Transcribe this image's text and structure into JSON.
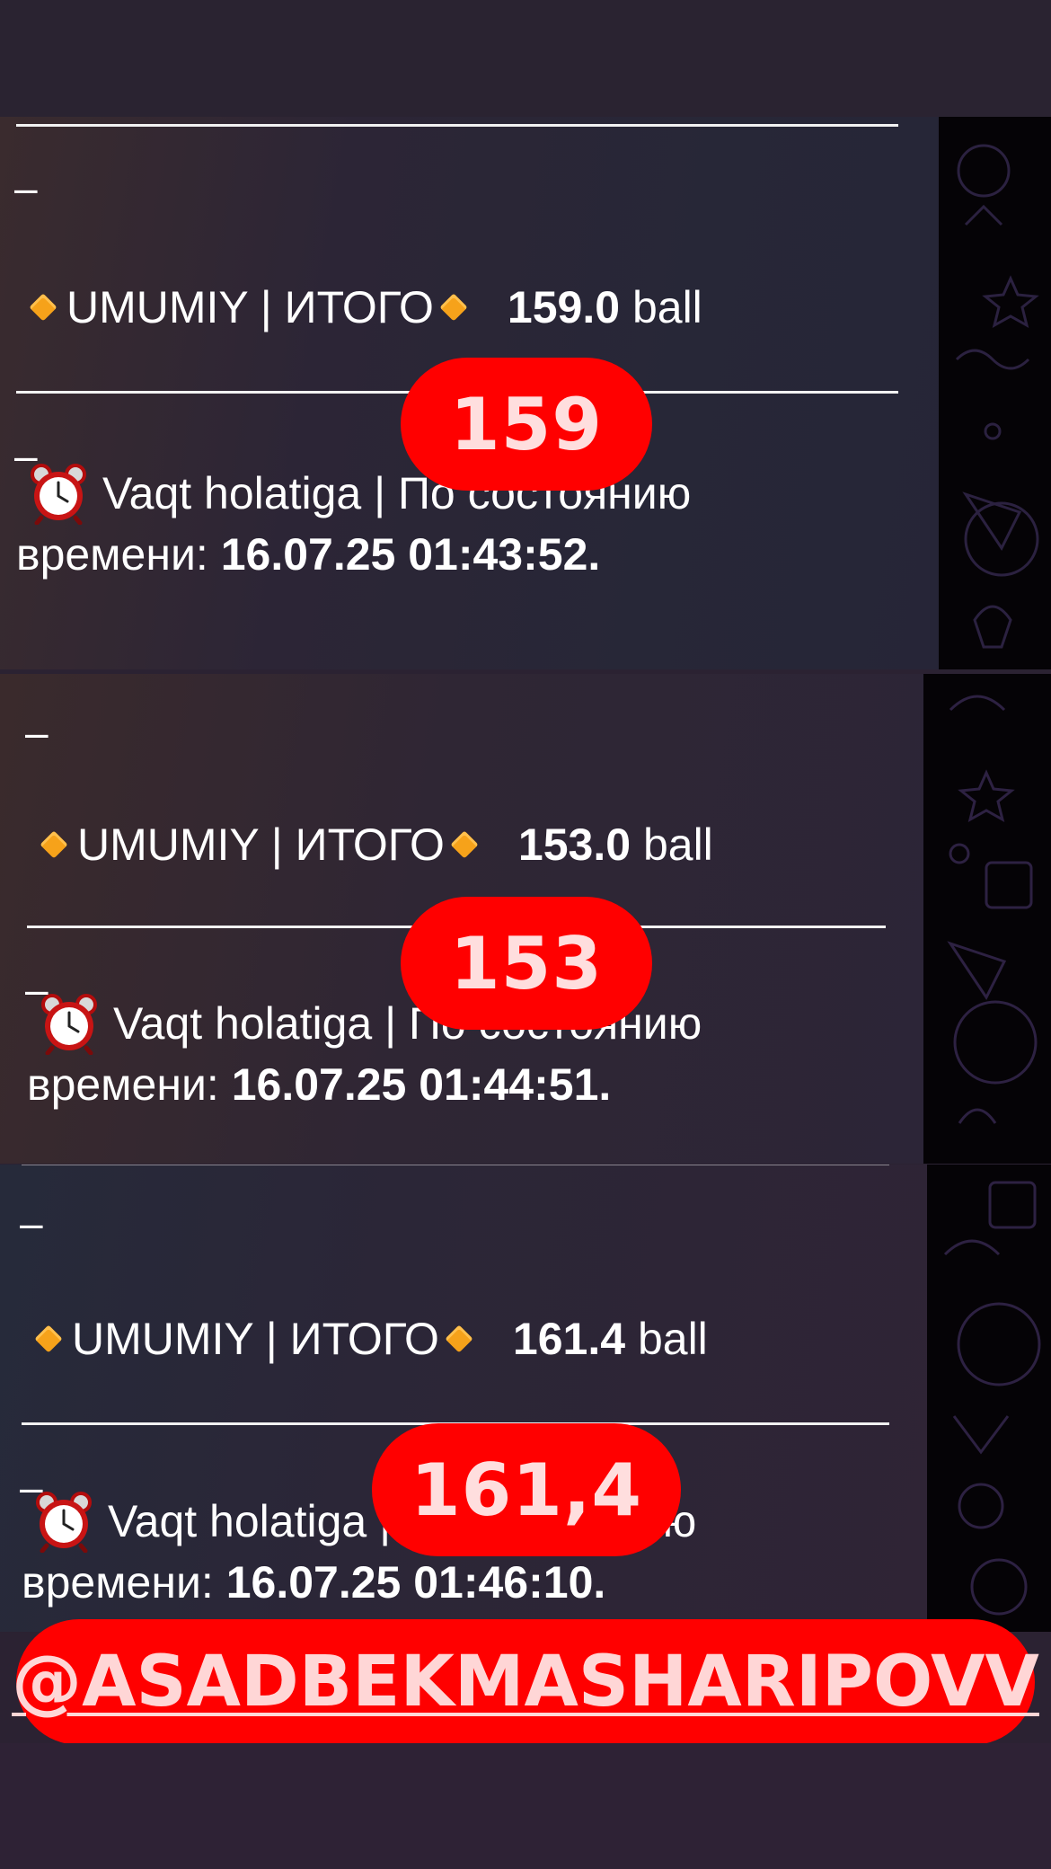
{
  "cards": [
    {
      "label": "UMUMIY | ИТОГО",
      "score": "159.0",
      "unit": "ball",
      "time_label": "Vaqt holatiga | По состоянию",
      "time_prefix": "времени:",
      "timestamp": "16.07.25 01:43:52.",
      "dash": "–",
      "overlay": "159"
    },
    {
      "label": "UMUMIY | ИТОГО",
      "score": "153.0",
      "unit": "ball",
      "time_label": "Vaqt holatiga | По состоянию",
      "time_prefix": "времени:",
      "timestamp": "16.07.25 01:44:51.",
      "dash": "–",
      "overlay": "153"
    },
    {
      "label": "UMUMIY | ИТОГО",
      "score": "161.4",
      "unit": "ball",
      "time_label": "Vaqt holatiga | По состоянию",
      "time_prefix": "времени:",
      "timestamp": "16.07.25 01:46:10.",
      "dash": "–",
      "overlay": "161,4"
    }
  ],
  "handle": "@ASADBEKMASHARIPOVV",
  "colors": {
    "overlay_red": "#ff0000",
    "diamond_orange": "#f6a21a",
    "background": "#2b2232"
  },
  "icons": [
    "orange-diamond-icon",
    "alarm-clock-icon"
  ]
}
